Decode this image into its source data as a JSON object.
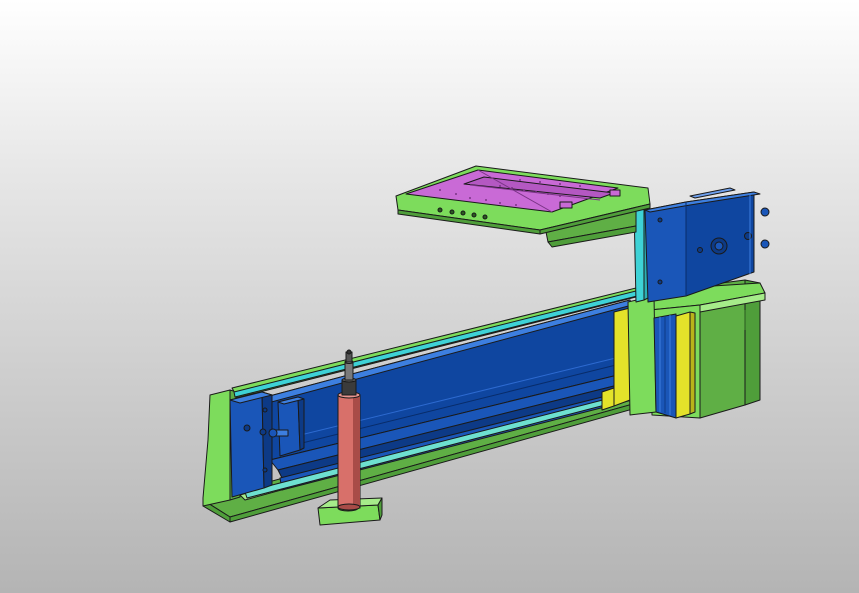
{
  "viewport": {
    "background_top": "#ffffff",
    "background_bottom": "#b4b4b4"
  },
  "palette": {
    "frame_green": "#7ddc5c",
    "frame_green_dark": "#4f9e3a",
    "frame_green_light": "#a6ec8a",
    "body_blue": "#1a56b8",
    "body_blue_dark": "#0d3a86",
    "body_blue_light": "#3d7fe0",
    "plate_magenta": "#c96ad6",
    "plate_magenta_dark": "#9a4aa6",
    "cylinder_red": "#d8706a",
    "cylinder_red_dark": "#a84c48",
    "block_yellow": "#e4e22a",
    "block_yellow_dark": "#b8b41a",
    "accent_cyan": "#3ed2d6",
    "outline": "#1a1a1a"
  },
  "components": [
    {
      "name": "base-frame",
      "color": "frame_green"
    },
    {
      "name": "linear-actuator-body",
      "color": "body_blue"
    },
    {
      "name": "end-cap",
      "color": "body_blue"
    },
    {
      "name": "carriage-slider",
      "color": "body_blue"
    },
    {
      "name": "sample-plate",
      "color": "plate_magenta"
    },
    {
      "name": "plate-carrier-arm",
      "color": "frame_green"
    },
    {
      "name": "vertical-cylinder",
      "color": "cylinder_red"
    },
    {
      "name": "cylinder-mount-base",
      "color": "frame_green"
    },
    {
      "name": "lift-actuator-block",
      "color": "body_blue"
    },
    {
      "name": "guide-block",
      "color": "block_yellow"
    },
    {
      "name": "cyan-spacer",
      "color": "accent_cyan"
    },
    {
      "name": "rear-support-bracket",
      "color": "frame_green"
    }
  ]
}
